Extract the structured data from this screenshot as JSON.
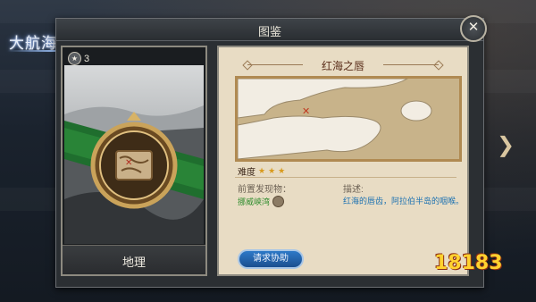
{
  "app": {
    "logo_text": "大航海之路"
  },
  "dialog": {
    "title": "图鉴",
    "close_label": "✕"
  },
  "card": {
    "rank": "3",
    "category": "地理"
  },
  "detail": {
    "region_title": "红海之唇",
    "difficulty_label": "难度",
    "difficulty_stars": 3,
    "prereq_label": "前置发现物：",
    "prereq_value": "挪威峡湾",
    "desc_label": "描述:",
    "desc_text": "红海的唇齿，阿拉伯半岛的咽喉。",
    "help_button": "请求协助"
  },
  "nav": {
    "next_icon": "chevron-right-icon"
  },
  "watermark": "18183",
  "colors": {
    "prereq": "#2f8c2d",
    "description": "#1f73b2",
    "star": "#d89a1c"
  }
}
